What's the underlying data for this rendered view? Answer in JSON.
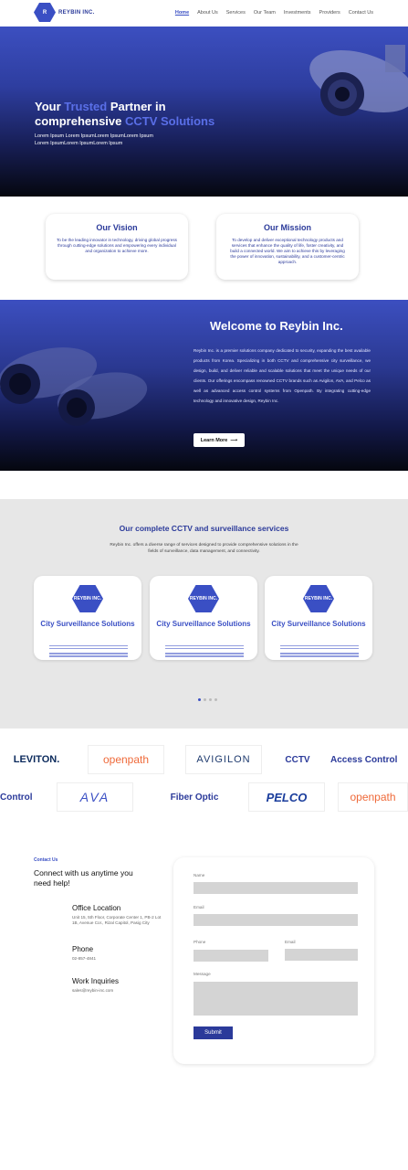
{
  "nav": {
    "logo_mark": "R",
    "logo_text": "REYBIN INC.",
    "links": [
      "Home",
      "About Us",
      "Services",
      "Our Team",
      "Investments",
      "Providers",
      "Contact Us"
    ]
  },
  "hero": {
    "title_1": "Your ",
    "title_hl1": "Trusted",
    "title_2": " Partner in",
    "title_3": "comprehensive ",
    "title_hl2": "CCTV Solutions",
    "subtitle": "Lorem Ipsum Lorem IpsumLorem IpsumLorem Ipsum Lorem IpsumLorem IpsumLorem Ipsum"
  },
  "vision": {
    "title": "Our Vision",
    "text": "To be the leading innovator in technology, driving global progress through cutting-edge solutions and empowering every individual and organization to achieve more."
  },
  "mission": {
    "title": "Our Mission",
    "text": "To develop and deliver exceptional technology products and services that enhance the quality of life, foster creativity, and build a connected world. We aim to achieve this by leveraging the power of innovation, sustainability, and a customer-centric approach."
  },
  "welcome": {
    "title": "Welcome to Reybin Inc.",
    "text": "Reybin Inc. is a premier solutions company dedicated to security, expanding the best available products from Korea. Specializing in both CCTV and comprehensive city surveillance, we design, build, and deliver reliable and scalable solutions that meet the unique needs of our clients. Our offerings encompass renowned CCTV brands such as Avigilon, AVA, and Pelco as well as advanced access control systems from Openpath. By integrating cutting-edge technology and innovative design, Reybin Inc.",
    "button": "Learn More"
  },
  "services": {
    "title": "Our complete CCTV and surveillance services",
    "subtitle": "Reybin Inc. offers a diverse range of services designed to provide comprehensive solutions in the fields of surveillance, data management, and connectivity.",
    "card_logo": "REYBIN INC.",
    "cards": [
      {
        "title": "City Surveillance Solutions"
      },
      {
        "title": "City Surveillance Solutions"
      },
      {
        "title": "City Surveillance Solutions"
      }
    ]
  },
  "brands": {
    "row1": [
      "LEVITON.",
      "openpath",
      "AVIGILON",
      "CCTV",
      "Access Control"
    ],
    "row2": [
      "Control",
      "AVA",
      "Fiber Optic",
      "PELCO",
      "openpath"
    ]
  },
  "contact": {
    "eyebrow": "Contact Us",
    "heading": "Connect with us anytime you need help!",
    "office_title": "Office Location",
    "office_text": "Unit 15, 5th Floor, Corporate Center 1, PB-2 Lot 1B, Avenue Cor., Rizal Capitol, Pasig City",
    "phone_title": "Phone",
    "phone_text": "02-857-4841",
    "work_title": "Work Inquiries",
    "work_text": "sales@reybin-inc.com",
    "form": {
      "name_label": "Name",
      "email_label": "Email",
      "phone_label": "Phone",
      "subject_label": "Email",
      "message_label": "Message",
      "submit": "Submit"
    }
  },
  "colors": {
    "brand_blue": "#3a4fc4",
    "dark_blue": "#2b3a9a",
    "highlight": "#5a6fe8"
  }
}
